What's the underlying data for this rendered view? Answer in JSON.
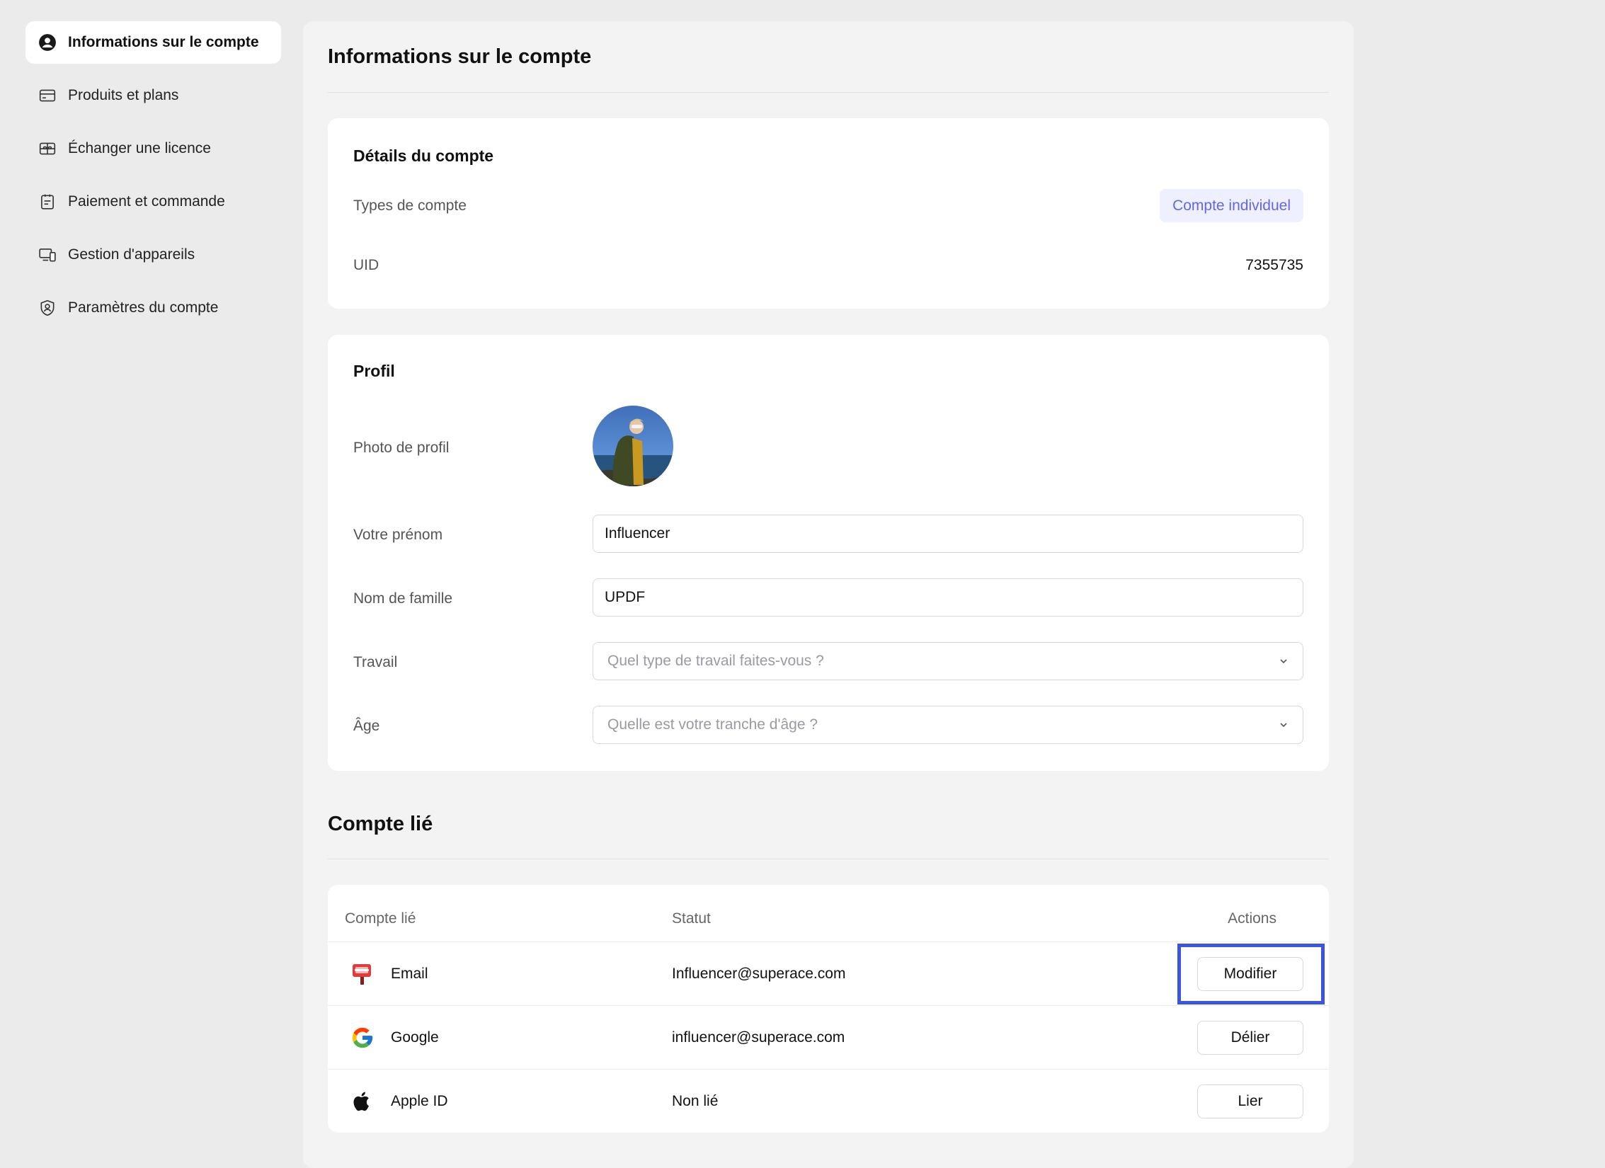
{
  "sidebar": {
    "items": [
      {
        "label": "Informations sur le compte",
        "icon": "user-circle-icon",
        "active": true
      },
      {
        "label": "Produits et plans",
        "icon": "credit-card-icon",
        "active": false
      },
      {
        "label": "Échanger une licence",
        "icon": "gift-icon",
        "active": false
      },
      {
        "label": "Paiement et commande",
        "icon": "clipboard-icon",
        "active": false
      },
      {
        "label": "Gestion d'appareils",
        "icon": "devices-icon",
        "active": false
      },
      {
        "label": "Paramètres du compte",
        "icon": "shield-user-icon",
        "active": false
      }
    ]
  },
  "main": {
    "title": "Informations sur le compte",
    "details": {
      "title": "Détails du compte",
      "account_type_label": "Types de compte",
      "account_type_value": "Compte individuel",
      "uid_label": "UID",
      "uid_value": "7355735"
    },
    "profile": {
      "title": "Profil",
      "photo_label": "Photo de profil",
      "first_name_label": "Votre prénom",
      "first_name_value": "Influencer",
      "last_name_label": "Nom de famille",
      "last_name_value": "UPDF",
      "job_label": "Travail",
      "job_placeholder": "Quel type de travail faites-vous ?",
      "age_label": "Âge",
      "age_placeholder": "Quelle est votre tranche d'âge ?"
    },
    "linked": {
      "title": "Compte lié",
      "columns": [
        "Compte lié",
        "Statut",
        "Actions"
      ],
      "rows": [
        {
          "name": "Email",
          "status": "Influencer@superace.com",
          "action": "Modifier",
          "icon": "mailbox-icon",
          "highlighted": true
        },
        {
          "name": "Google",
          "status": "influencer@superace.com",
          "action": "Délier",
          "icon": "google-icon",
          "highlighted": false
        },
        {
          "name": "Apple ID",
          "status": "Non lié",
          "action": "Lier",
          "icon": "apple-icon",
          "highlighted": false
        }
      ]
    }
  },
  "colors": {
    "accent": "#6366e8",
    "badge_bg": "#eef0ff",
    "highlight": "#3b55e0"
  }
}
